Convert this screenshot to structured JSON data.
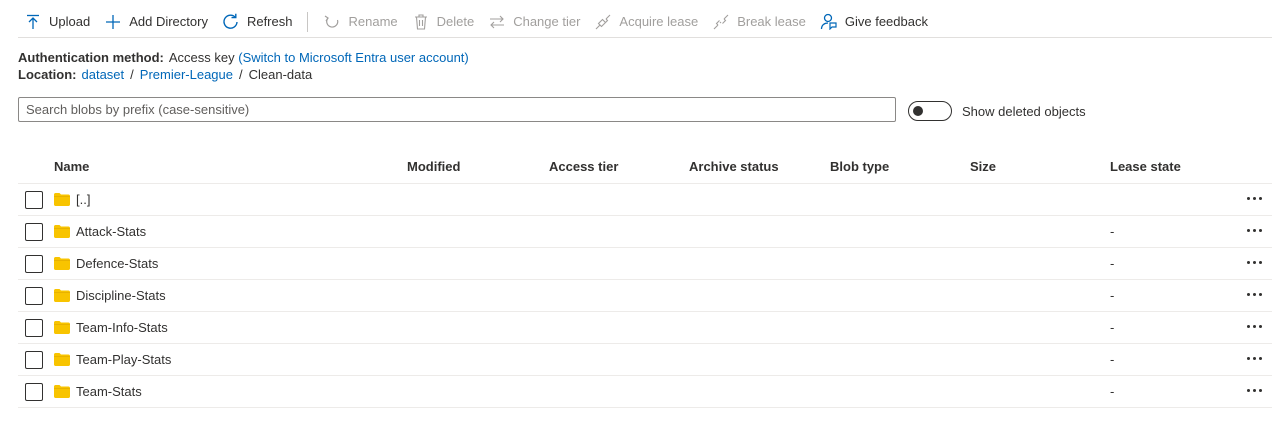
{
  "toolbar": {
    "upload": "Upload",
    "add_directory": "Add Directory",
    "refresh": "Refresh",
    "rename": "Rename",
    "delete": "Delete",
    "change_tier": "Change tier",
    "acquire_lease": "Acquire lease",
    "break_lease": "Break lease",
    "give_feedback": "Give feedback"
  },
  "info": {
    "auth_label": "Authentication method:",
    "auth_value": "Access key",
    "auth_link": "(Switch to Microsoft Entra user account)",
    "location_label": "Location:",
    "crumbs": [
      "dataset",
      "Premier-League",
      "Clean-data"
    ],
    "crumb_sep": "/"
  },
  "search": {
    "placeholder": "Search blobs by prefix (case-sensitive)"
  },
  "toggle": {
    "label": "Show deleted objects"
  },
  "table": {
    "headers": [
      "Name",
      "Modified",
      "Access tier",
      "Archive status",
      "Blob type",
      "Size",
      "Lease state"
    ],
    "rows": [
      {
        "name": "[..]",
        "lease": ""
      },
      {
        "name": "Attack-Stats",
        "lease": "-"
      },
      {
        "name": "Defence-Stats",
        "lease": "-"
      },
      {
        "name": "Discipline-Stats",
        "lease": "-"
      },
      {
        "name": "Team-Info-Stats",
        "lease": "-"
      },
      {
        "name": "Team-Play-Stats",
        "lease": "-"
      },
      {
        "name": "Team-Stats",
        "lease": "-"
      }
    ]
  },
  "colors": {
    "accent": "#0067b8",
    "folder": "#f8c400",
    "disabled": "#a19f9d"
  }
}
